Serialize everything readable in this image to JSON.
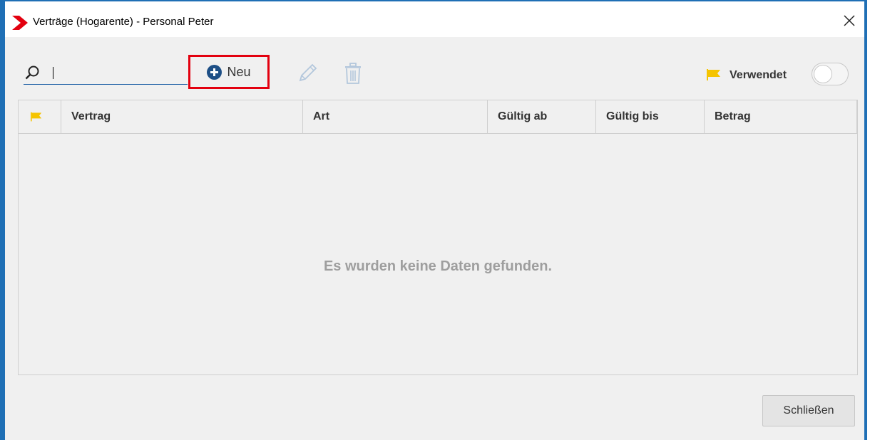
{
  "window": {
    "title": "Verträge (Hogarente) - Personal Peter",
    "accent_color": "#1f6fb5",
    "logo_color": "#e3000f"
  },
  "toolbar": {
    "search": {
      "value": "",
      "placeholder": ""
    },
    "new_label": "Neu",
    "edit_icon": "pencil-icon",
    "delete_icon": "trash-icon",
    "highlight_color": "#e3000f",
    "verwendet_label": "Verwendet",
    "verwendet_toggle_on": false,
    "flag_color": "#f5c400"
  },
  "table": {
    "columns": [
      "",
      "Vertrag",
      "Art",
      "Gültig ab",
      "Gültig bis",
      "Betrag"
    ],
    "rows": [],
    "empty_message": "Es wurden keine Daten gefunden."
  },
  "footer": {
    "close_label": "Schließen"
  }
}
